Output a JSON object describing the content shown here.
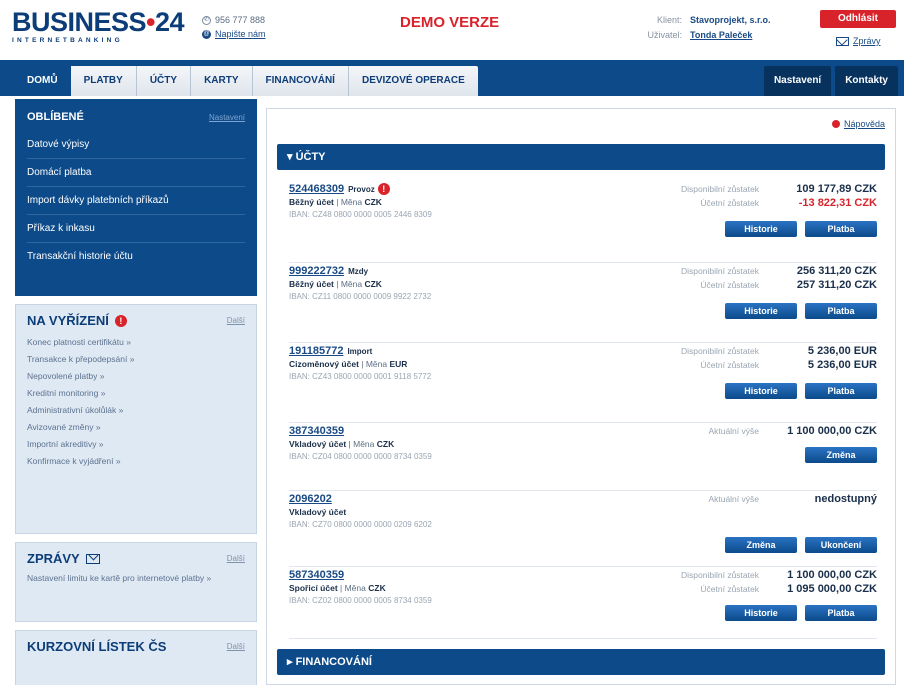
{
  "header": {
    "logo_main": "BUSINESS",
    "logo_dot": "•",
    "logo_num": "24",
    "logo_sub": "INTERNETBANKING",
    "phone": "956 777 888",
    "write_us": "Napište nám",
    "demo": "DEMO VERZE",
    "client_label": "Klient:",
    "client_value": "Stavoprojekt, s.r.o.",
    "user_label": "Uživatel:",
    "user_value": "Tonda Paleček",
    "logout": "Odhlásit",
    "messages": "Zprávy"
  },
  "nav": {
    "tabs": [
      {
        "label": "Domů"
      },
      {
        "label": "Platby"
      },
      {
        "label": "Účty"
      },
      {
        "label": "Karty"
      },
      {
        "label": "Financování"
      },
      {
        "label": "Devizové operace"
      }
    ],
    "right_tabs": [
      {
        "label": "Nastavení"
      },
      {
        "label": "Kontakty"
      }
    ]
  },
  "favorites": {
    "title": "OBLÍBENÉ",
    "settings": "Nastavení",
    "items": [
      "Datové výpisy",
      "Domácí platba",
      "Import dávky platebních příkazů",
      "Příkaz k inkasu",
      "Transakční historie účtu"
    ]
  },
  "pending": {
    "title": "NA VYŘÍZENÍ",
    "badge": "!",
    "more": "Další",
    "items": [
      "Konec platnosti certifikátu »",
      "Transakce k přepodepsání »",
      "Nepovolené platby »",
      "Kreditní monitoring »",
      "Administrativní úkolůlák »",
      "Avizované změny »",
      "Importní akreditivy »",
      "Konfirmace k vyjádření »"
    ]
  },
  "messages_box": {
    "title": "ZPRÁVY",
    "more": "Další",
    "text": "Nastavení limitu ke kartě pro internetové platby »"
  },
  "rates": {
    "title": "KURZOVNÍ LÍSTEK ČS",
    "more": "Další"
  },
  "main": {
    "help": "Nápověda",
    "section_accounts": "▾ ÚČTY",
    "section_financing": "▸ FINANCOVÁNÍ",
    "accounts": [
      {
        "number": "524468309",
        "name": "Provoz",
        "alert": "!",
        "type": "Běžný účet",
        "currency_label": "Měna",
        "currency": "CZK",
        "iban": "IBAN: CZ48 0800 0000 0005 2446 8309",
        "lines": [
          {
            "label": "Disponibilní zůstatek",
            "value": "109 177,89 CZK",
            "negative": false
          },
          {
            "label": "Účetní zůstatek",
            "value": "-13 822,31 CZK",
            "negative": true
          }
        ],
        "buttons": [
          "Historie",
          "Platba"
        ]
      },
      {
        "number": "999222732",
        "name": "Mzdy",
        "type": "Běžný účet",
        "currency_label": "Měna",
        "currency": "CZK",
        "iban": "IBAN: CZ11 0800 0000 0009 9922 2732",
        "lines": [
          {
            "label": "Disponibilní zůstatek",
            "value": "256 311,20 CZK",
            "negative": false
          },
          {
            "label": "Účetní zůstatek",
            "value": "257 311,20 CZK",
            "negative": false
          }
        ],
        "buttons": [
          "Historie",
          "Platba"
        ]
      },
      {
        "number": "191185772",
        "name": "Import",
        "type": "Cizoměnový účet",
        "currency_label": "Měna",
        "currency": "EUR",
        "iban": "IBAN: CZ43 0800 0000 0001 9118 5772",
        "lines": [
          {
            "label": "Disponibilní zůstatek",
            "value": "5 236,00 EUR",
            "negative": false
          },
          {
            "label": "Účetní zůstatek",
            "value": "5 236,00 EUR",
            "negative": false
          }
        ],
        "buttons": [
          "Historie",
          "Platba"
        ]
      },
      {
        "number": "387340359",
        "name": "",
        "type": "Vkladový účet",
        "currency_label": "Měna",
        "currency": "CZK",
        "iban": "IBAN: CZ04 0800 0000 0000 8734 0359",
        "lines": [
          {
            "label": "Aktuální výše",
            "value": "1 100 000,00 CZK",
            "negative": false
          }
        ],
        "buttons": [
          "Změna"
        ]
      },
      {
        "number": "2096202",
        "name": "",
        "type": "Vkladový účet",
        "currency_label": "",
        "currency": "",
        "iban": "IBAN: CZ70 0800 0000 0000 0209 6202",
        "lines": [
          {
            "label": "Aktuální výše",
            "value": "nedostupný",
            "negative": false
          }
        ],
        "buttons": [
          "Změna",
          "Ukončení"
        ]
      },
      {
        "number": "587340359",
        "name": "",
        "type": "Spořicí účet",
        "currency_label": "Měna",
        "currency": "CZK",
        "iban": "IBAN: CZ02 0800 0000 0005 8734 0359",
        "lines": [
          {
            "label": "Disponibilní zůstatek",
            "value": "1 100 000,00 CZK",
            "negative": false
          },
          {
            "label": "Účetní zůstatek",
            "value": "1 095 000,00 CZK",
            "negative": false
          }
        ],
        "buttons": [
          "Historie",
          "Platba"
        ]
      }
    ]
  }
}
